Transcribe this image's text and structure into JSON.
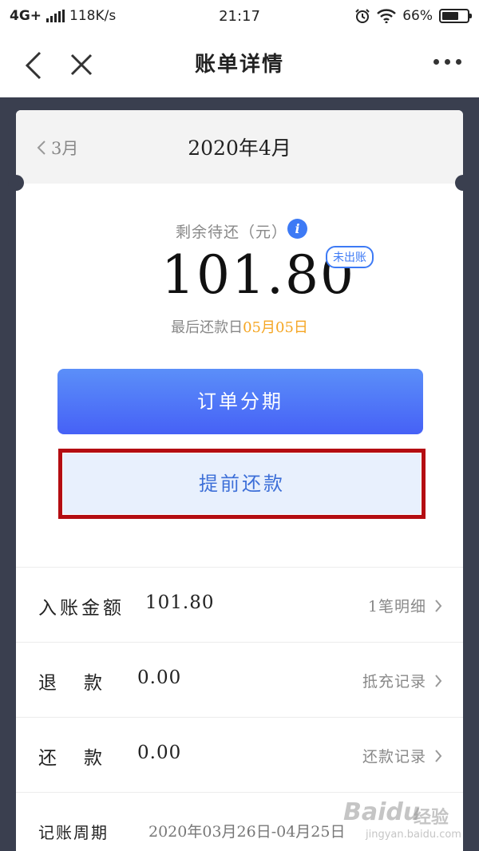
{
  "status_bar": {
    "network": "4G+",
    "speed": "118K/s",
    "time": "21:17",
    "battery_percent": "66%",
    "battery_level": 0.66
  },
  "nav": {
    "title": "账单详情",
    "back_icon": "chevron-left-icon",
    "close_icon": "close-icon",
    "more_icon": "more-dots-icon"
  },
  "bill": {
    "prev_month": "3月",
    "current_month": "2020年4月",
    "remaining_label": "剩余待还（元）",
    "remaining_amount": "101.80",
    "status_badge": "未出账",
    "due_prefix": "最后还款日",
    "due_date": "05月05日"
  },
  "actions": {
    "installment": "订单分期",
    "prepay": "提前还款"
  },
  "details": [
    {
      "label": "入账金额",
      "value": "101.80",
      "link": "1笔明细"
    },
    {
      "label": "退款",
      "value": "0.00",
      "link": "抵充记录"
    },
    {
      "label": "还款",
      "value": "0.00",
      "link": "还款记录"
    }
  ],
  "period": {
    "label": "记账周期",
    "value": "2020年03月26日-04月25日"
  },
  "watermark": {
    "logo": "Baidu",
    "text": "经验",
    "url": "jingyan.baidu.com"
  },
  "colors": {
    "accent_blue": "#3d7af5",
    "due_orange": "#f5a623",
    "highlight_red": "#b40d12",
    "page_dark": "#3a3f4f"
  }
}
